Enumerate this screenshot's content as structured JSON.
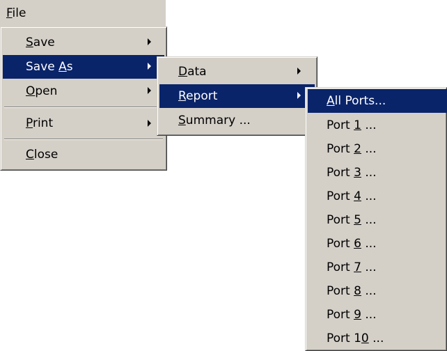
{
  "menubar": {
    "file": {
      "pre": "",
      "key": "F",
      "post": "ile"
    }
  },
  "file_menu": {
    "items": [
      {
        "pre": "",
        "key": "S",
        "post": "ave",
        "submenu": true
      },
      {
        "pre": "Save ",
        "key": "A",
        "post": "s",
        "submenu": true
      },
      {
        "pre": "",
        "key": "O",
        "post": "pen",
        "submenu": true
      },
      {
        "pre": "",
        "key": "P",
        "post": "rint",
        "submenu": true
      },
      {
        "pre": "",
        "key": "C",
        "post": "lose",
        "submenu": false
      }
    ]
  },
  "saveas_menu": {
    "items": [
      {
        "pre": "",
        "key": "D",
        "post": "ata",
        "submenu": true
      },
      {
        "pre": "",
        "key": "R",
        "post": "eport",
        "submenu": true
      },
      {
        "pre": "",
        "key": "S",
        "post": "ummary ...",
        "submenu": false
      }
    ]
  },
  "report_menu": {
    "items": [
      {
        "pre": "",
        "key": "A",
        "post": "ll Ports..."
      },
      {
        "pre": "Port ",
        "key": "1",
        "post": " ..."
      },
      {
        "pre": "Port ",
        "key": "2",
        "post": " ..."
      },
      {
        "pre": "Port ",
        "key": "3",
        "post": " ..."
      },
      {
        "pre": "Port ",
        "key": "4",
        "post": " ..."
      },
      {
        "pre": "Port ",
        "key": "5",
        "post": " ..."
      },
      {
        "pre": "Port ",
        "key": "6",
        "post": " ..."
      },
      {
        "pre": "Port ",
        "key": "7",
        "post": " ..."
      },
      {
        "pre": "Port ",
        "key": "8",
        "post": " ..."
      },
      {
        "pre": "Port ",
        "key": "9",
        "post": " ..."
      },
      {
        "pre": "Port 1",
        "key": "0",
        "post": " ..."
      }
    ]
  },
  "colors": {
    "menu_bg": "#d4d0c8",
    "highlight": "#0a246a",
    "highlight_text": "#ffffff"
  }
}
